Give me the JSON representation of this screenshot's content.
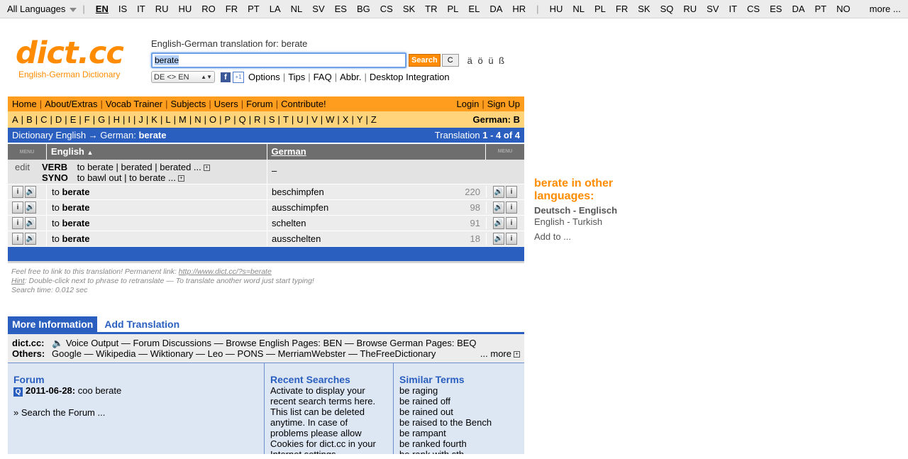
{
  "langbar": {
    "all_label": "All Languages",
    "group1": [
      "EN",
      "IS",
      "IT",
      "RU",
      "HU",
      "RO",
      "FR",
      "PT",
      "LA",
      "NL",
      "SV",
      "ES",
      "BG",
      "CS",
      "SK",
      "TR",
      "PL",
      "EL",
      "DA",
      "HR"
    ],
    "group2": [
      "HU",
      "NL",
      "PL",
      "FR",
      "SK",
      "SQ",
      "RU",
      "SV",
      "IT",
      "CS",
      "ES",
      "DA",
      "PT",
      "NO"
    ],
    "more": "more ..."
  },
  "logo": {
    "title": "dict.cc",
    "subtitle": "English-German Dictionary"
  },
  "search": {
    "label": "English-German translation for: berate",
    "value": "berate",
    "button": "Search",
    "clear": "C",
    "chars": "ä ö ü ß",
    "direction": "DE <> EN",
    "links": [
      "Options",
      "Tips",
      "FAQ",
      "Abbr.",
      "Desktop Integration"
    ]
  },
  "nav": {
    "left": [
      "Home",
      "About/Extras",
      "Vocab Trainer",
      "Subjects",
      "Users",
      "Forum",
      "Contribute!"
    ],
    "right": [
      "Login",
      "Sign Up"
    ]
  },
  "alphabet": {
    "letters": [
      "A",
      "B",
      "C",
      "D",
      "E",
      "F",
      "G",
      "H",
      "I",
      "J",
      "K",
      "L",
      "M",
      "N",
      "O",
      "P",
      "Q",
      "R",
      "S",
      "T",
      "U",
      "V",
      "W",
      "X",
      "Y",
      "Z"
    ],
    "current": "German: B"
  },
  "dict": {
    "title": "Dictionary English → German:",
    "word": "berate",
    "count_prefix": "Translation",
    "count": "1 - 4 of 4",
    "col_en": "English",
    "col_de": "German",
    "menu": "MENU",
    "edit": "edit",
    "verb_label": "VERB",
    "verb_forms": "to berate | berated | berated ...",
    "syno_label": "SYNO",
    "syno_text": "to bawl out | to berate ...",
    "dash": "–",
    "rows": [
      {
        "en_prefix": "to",
        "en_word": "berate",
        "de": "beschimpfen",
        "n": "220"
      },
      {
        "en_prefix": "to",
        "en_word": "berate",
        "de": "ausschimpfen",
        "n": "98"
      },
      {
        "en_prefix": "to",
        "en_word": "berate",
        "de": "schelten",
        "n": "91"
      },
      {
        "en_prefix": "to",
        "en_word": "berate",
        "de": "ausschelten",
        "n": "18"
      }
    ]
  },
  "notes": {
    "line1": "Feel free to link to this translation! Permanent link:",
    "link": "http://www.dict.cc/?s=berate",
    "hint_label": "Hint",
    "hint": ": Double-click next to phrase to retranslate — To translate another word just start typing!",
    "time": "Search time: 0.012 sec"
  },
  "side": {
    "heading": "berate in other languages:",
    "l1": "Deutsch - Englisch",
    "l2": "English - Turkish",
    "l3": "Add to ..."
  },
  "info": {
    "tab1": "More Information",
    "tab2": "Add Translation",
    "dict_label": "dict.cc:",
    "dict_links": "Voice Output — Forum Discussions — Browse English Pages: BEN — Browse German Pages: BEQ",
    "others_label": "Others:",
    "others_links": "Google — Wikipedia — Wiktionary — Leo — PONS — MerriamWebster — TheFreeDictionary",
    "more": "... more",
    "forum_title": "Forum",
    "forum_date": "2011-06-28:",
    "forum_entry": "coo berate",
    "forum_search": "» Search the Forum ...",
    "recent_title": "Recent Searches",
    "recent_text": "Activate to display your recent search terms here. This list can be deleted anytime. In case of problems please allow Cookies for dict.cc in your Internet settings.",
    "similar_title": "Similar Terms",
    "similar": [
      "be raging",
      "be rained off",
      "be rained out",
      "be raised to the Bench",
      "be rampant",
      "be ranked fourth",
      "be rank with sth."
    ]
  }
}
